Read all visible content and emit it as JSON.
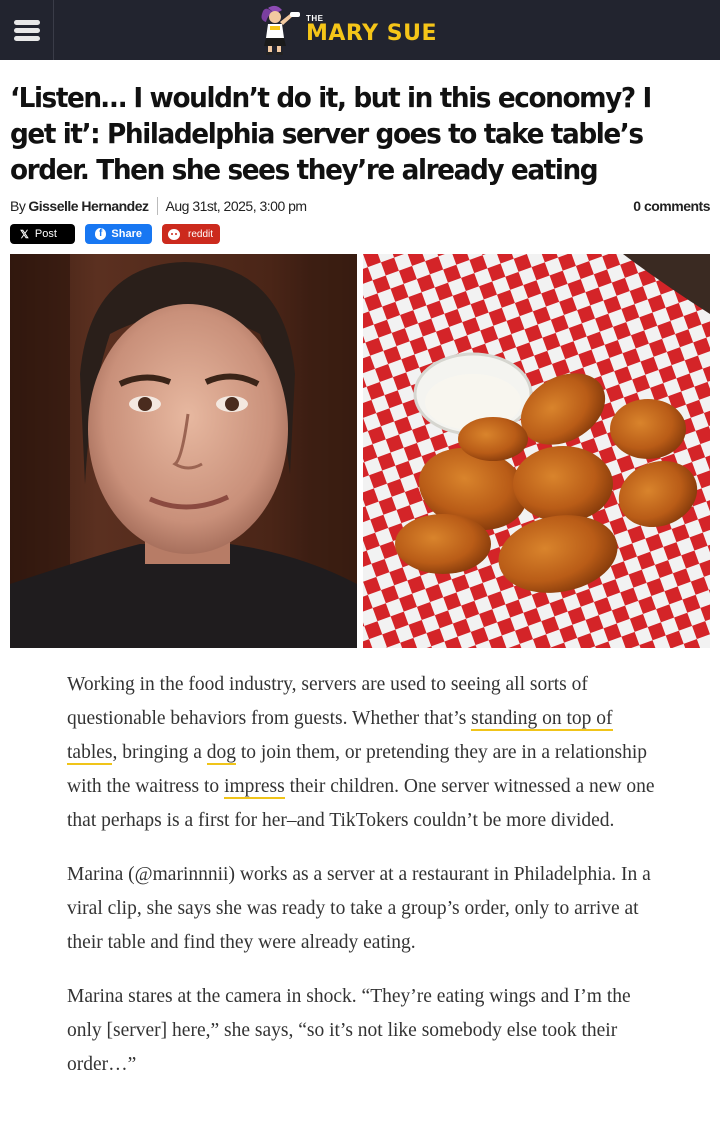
{
  "header": {
    "logo_the": "THE",
    "logo_name": "MARY SUE"
  },
  "article": {
    "title": "‘Listen… I wouldn’t do it, but in this economy? I get it’: Philadelphia server goes to take table’s order. Then she sees they’re already eating",
    "byline_prefix": "By",
    "author": "Gisselle Hernandez",
    "date": "Aug 31st, 2025, 3:00 pm",
    "comments": "0 comments"
  },
  "share": {
    "x_label": "Post",
    "x_icon": "x-logo-icon",
    "fb_label": "Share",
    "fb_icon": "facebook-icon",
    "reddit_label": "reddit",
    "reddit_icon": "reddit-alien-icon"
  },
  "paragraphs": {
    "p1": {
      "t1": "Working in the food industry, servers are used to seeing all sorts of questionable behaviors from guests. Whether that’s ",
      "l1": "standing on top of tables",
      "t2": ", bringing a ",
      "l2": "dog",
      "t3": " to join them, or pretending they are in a relationship with the waitress to ",
      "l3": "impress",
      "t4": " their children. One server witnessed a new one that perhaps is a first for her–and TikTokers couldn’t be more divided."
    },
    "p2": "Marina (@marinnnii) works as a server at a restaurant in Philadelphia. In a viral clip, she says she was ready to take a group’s order, only to arrive at their table and find they were already eating.",
    "p3": "Marina stares at the camera in shock. “They’re eating wings and I’m the only [server] here,” she says, “so it’s not like somebody else took their order…”"
  },
  "colors": {
    "header_bg": "#22242f",
    "logo_yellow": "#f5c518",
    "link_underline": "#f0c419",
    "facebook": "#1877f2",
    "reddit": "#cc2a1d"
  }
}
